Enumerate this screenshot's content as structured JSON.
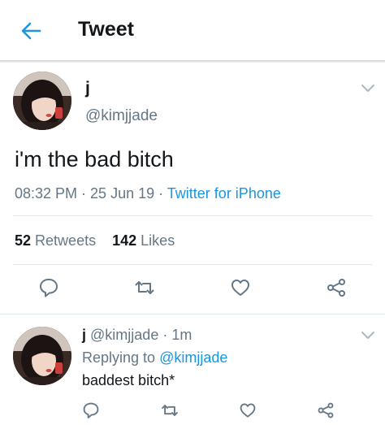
{
  "header": {
    "title": "Tweet",
    "back_icon": "arrow-left-icon"
  },
  "tweet": {
    "name": "j",
    "handle": "@kimjjade",
    "text": "i'm the bad bitch",
    "time": "08:32 PM",
    "date": "25 Jun 19",
    "source": "Twitter for iPhone",
    "retweet_count": "52",
    "retweet_label": "Retweets",
    "like_count": "142",
    "like_label": "Likes"
  },
  "reply": {
    "name": "j",
    "handle": "@kimjjade",
    "age": "1m",
    "replying_to_label": "Replying to",
    "replying_to_handle": "@kimjjade",
    "text": "baddest bitch*"
  },
  "icons": [
    "reply-icon",
    "retweet-icon",
    "like-icon",
    "share-icon",
    "chevron-down-icon"
  ],
  "colors": {
    "accent": "#1b95e0",
    "muted": "#657786",
    "text": "#14171a",
    "divider": "#e1e8ed"
  }
}
